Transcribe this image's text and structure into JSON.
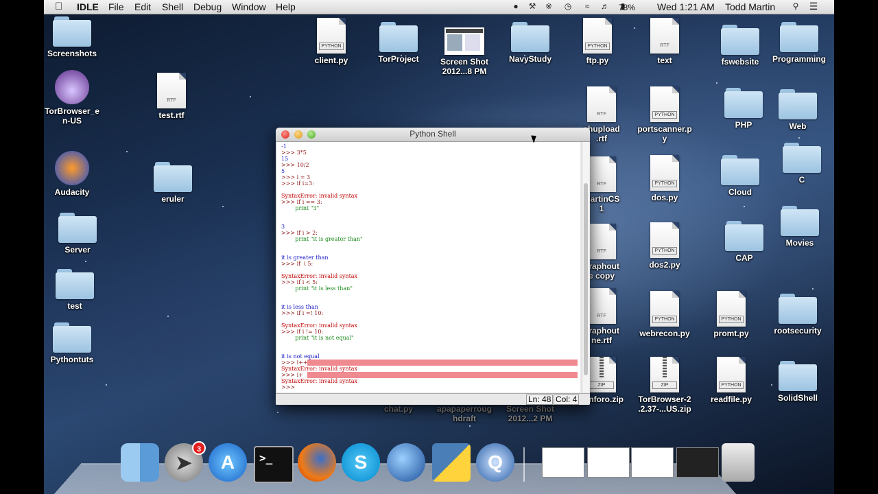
{
  "menubar": {
    "app_name": "IDLE",
    "menus": [
      "File",
      "Edit",
      "Shell",
      "Debug",
      "Window",
      "Help"
    ],
    "battery": "78%",
    "clock": "Wed 1:21 AM",
    "user": "Todd Martin"
  },
  "desktop_icons": [
    {
      "label": "Screenshots",
      "kind": "folder"
    },
    {
      "label": "TorBrowser_e\nn-US",
      "kind": "app"
    },
    {
      "label": "Audacity",
      "kind": "app"
    },
    {
      "label": "Server",
      "kind": "folder"
    },
    {
      "label": "test",
      "kind": "folder"
    },
    {
      "label": "Pythontuts",
      "kind": "folder"
    },
    {
      "label": "test.rtf",
      "kind": "rtf"
    },
    {
      "label": "eruler",
      "kind": "folder"
    },
    {
      "label": "client.py",
      "kind": "python"
    },
    {
      "label": "TorProject",
      "kind": "folder"
    },
    {
      "label": "Screen Shot\n2012...8 PM",
      "kind": "thumb"
    },
    {
      "label": "NavyStudy",
      "kind": "folder"
    },
    {
      "label": "ftp.py",
      "kind": "python"
    },
    {
      "label": "text",
      "kind": "rtf"
    },
    {
      "label": "fswebsite",
      "kind": "folder"
    },
    {
      "label": "Programming",
      "kind": "folder"
    },
    {
      "label": "PHP",
      "kind": "folder"
    },
    {
      "label": "Web",
      "kind": "folder"
    },
    {
      "label": "portscanner.p\ny",
      "kind": "python"
    },
    {
      "label": "Cloud",
      "kind": "folder"
    },
    {
      "label": "C",
      "kind": "folder"
    },
    {
      "label": "dos.py",
      "kind": "python"
    },
    {
      "label": "CAP",
      "kind": "folder"
    },
    {
      "label": "Movies",
      "kind": "folder"
    },
    {
      "label": "dos2.py",
      "kind": "python"
    },
    {
      "label": "webrecon.py",
      "kind": "python"
    },
    {
      "label": "promt.py",
      "kind": "python"
    },
    {
      "label": "rootsecurity",
      "kind": "folder"
    },
    {
      "label": "TorBrowser-2\n.2.37-...US.zip",
      "kind": "zip"
    },
    {
      "label": "readfile.py",
      "kind": "python"
    },
    {
      "label": "SolidShell",
      "kind": "folder"
    },
    {
      "label": "shupload\n.rtf",
      "kind": "rtf"
    },
    {
      "label": "MartinCS\n1",
      "kind": "rtf"
    },
    {
      "label": "graphout\ne copy",
      "kind": "rtf"
    },
    {
      "label": "graphout\nne.rtf",
      "kind": "rtf"
    },
    {
      "label": "xenforo.zip",
      "kind": "zip"
    },
    {
      "label": "chat.py",
      "kind": "hidden"
    },
    {
      "label": "apapaperroug\nhdraft",
      "kind": "hidden"
    },
    {
      "label": "Screen Shot\n2012...2 PM",
      "kind": "hidden"
    }
  ],
  "doc_tags": {
    "python": "PYTHON",
    "rtf": "RTF",
    "zip": "ZIP"
  },
  "window": {
    "title": "Python Shell",
    "status_line": "Ln: 48",
    "status_col": "Col: 4"
  },
  "shell_lines": [
    {
      "text": "-1",
      "style": "out"
    },
    {
      "text": ">>> 3*5",
      "style": "prompt"
    },
    {
      "text": "15",
      "style": "out"
    },
    {
      "text": ">>> 10/2",
      "style": "prompt"
    },
    {
      "text": "5",
      "style": "out"
    },
    {
      "text": ">>> i = 3",
      "style": "prompt"
    },
    {
      "text": ">>> if i=3:",
      "style": "prompt"
    },
    {
      "text": "",
      "style": "out"
    },
    {
      "text": "SyntaxError: invalid syntax",
      "style": "err"
    },
    {
      "text": ">>> if i == 3:",
      "style": "prompt"
    },
    {
      "text": "        print \"3\"",
      "style": "str"
    },
    {
      "text": "",
      "style": "out"
    },
    {
      "text": "",
      "style": "out"
    },
    {
      "text": "3",
      "style": "out"
    },
    {
      "text": ">>> if i > 2:",
      "style": "prompt"
    },
    {
      "text": "        print \"it is greater than\"",
      "style": "str"
    },
    {
      "text": "",
      "style": "out"
    },
    {
      "text": "",
      "style": "out"
    },
    {
      "text": "it is greater than",
      "style": "out"
    },
    {
      "text": ">>> if  i 5:",
      "style": "prompt"
    },
    {
      "text": "",
      "style": "out"
    },
    {
      "text": "SyntaxError: invalid syntax",
      "style": "err"
    },
    {
      "text": ">>> if i < 5:",
      "style": "prompt"
    },
    {
      "text": "        print \"it is less than\"",
      "style": "str"
    },
    {
      "text": "",
      "style": "out"
    },
    {
      "text": "",
      "style": "out"
    },
    {
      "text": "it is less than",
      "style": "out"
    },
    {
      "text": ">>> if i =! 10:",
      "style": "prompt"
    },
    {
      "text": "",
      "style": "out"
    },
    {
      "text": "SyntaxError: invalid syntax",
      "style": "err"
    },
    {
      "text": ">>> if i != 10:",
      "style": "prompt"
    },
    {
      "text": "        print \"it is not equal\"",
      "style": "str"
    },
    {
      "text": "",
      "style": "out"
    },
    {
      "text": "",
      "style": "out"
    },
    {
      "text": "it is not equal",
      "style": "out"
    },
    {
      "text": ">>> i++",
      "style": "prompt"
    },
    {
      "text": "SyntaxError: invalid syntax",
      "style": "err"
    },
    {
      "text": ">>> i+",
      "style": "prompt"
    },
    {
      "text": "SyntaxError: invalid syntax",
      "style": "err"
    },
    {
      "text": ">>>",
      "style": "prompt"
    }
  ],
  "dock": {
    "apps": [
      "finder-icon",
      "launchpad-icon",
      "app-store-icon",
      "terminal-icon",
      "firefox-icon",
      "skype-icon",
      "thunderbird-icon",
      "python-icon",
      "quicktime-icon"
    ],
    "app_store_badge": "3",
    "terminal_glyph": ">_"
  },
  "colors": {
    "accent": "#ef8a90",
    "error": "#c00000",
    "string": "#1b8a1b"
  }
}
